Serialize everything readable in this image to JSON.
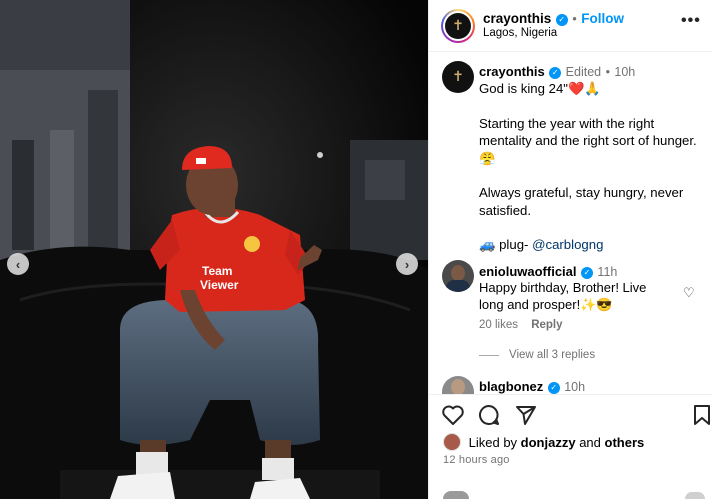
{
  "post": {
    "username": "crayonthis",
    "follow_label": "Follow",
    "location": "Lagos, Nigeria",
    "more_label": "•••"
  },
  "caption": {
    "username": "crayonthis",
    "edited_label": "Edited",
    "time": "10h",
    "line1": "God is king 24\"",
    "line1_emoji": "❤️🙏",
    "para2": "Starting the year with the right mentality and the right sort of hunger.",
    "para2_emoji": "😤",
    "para3": "Always grateful, stay hungry, never satisfied.",
    "plug_emoji": "🚙",
    "plug_label": "plug-",
    "plug_handle": "@carblogng"
  },
  "comments": [
    {
      "username": "enioluwaofficial",
      "time": "11h",
      "text": "Happy birthday, Brother! Live long and prosper!",
      "emoji": "✨😎",
      "likes": "20 likes",
      "reply_label": "Reply",
      "view_replies": "View all 3 replies"
    },
    {
      "username": "blagbonez",
      "time": "10h"
    }
  ],
  "likes": {
    "liked_by": "Liked by",
    "user": "donjazzy",
    "and_others": "and",
    "others": "others"
  },
  "timestamp": "12 hours ago",
  "photo": {
    "jersey_text_line1": "Team",
    "jersey_text_line2": "Viewer",
    "prev_icon": "‹",
    "next_icon": "›"
  },
  "colors": {
    "accent": "#0095f6",
    "jersey": "#d8281c",
    "heart": "#ed4956"
  }
}
